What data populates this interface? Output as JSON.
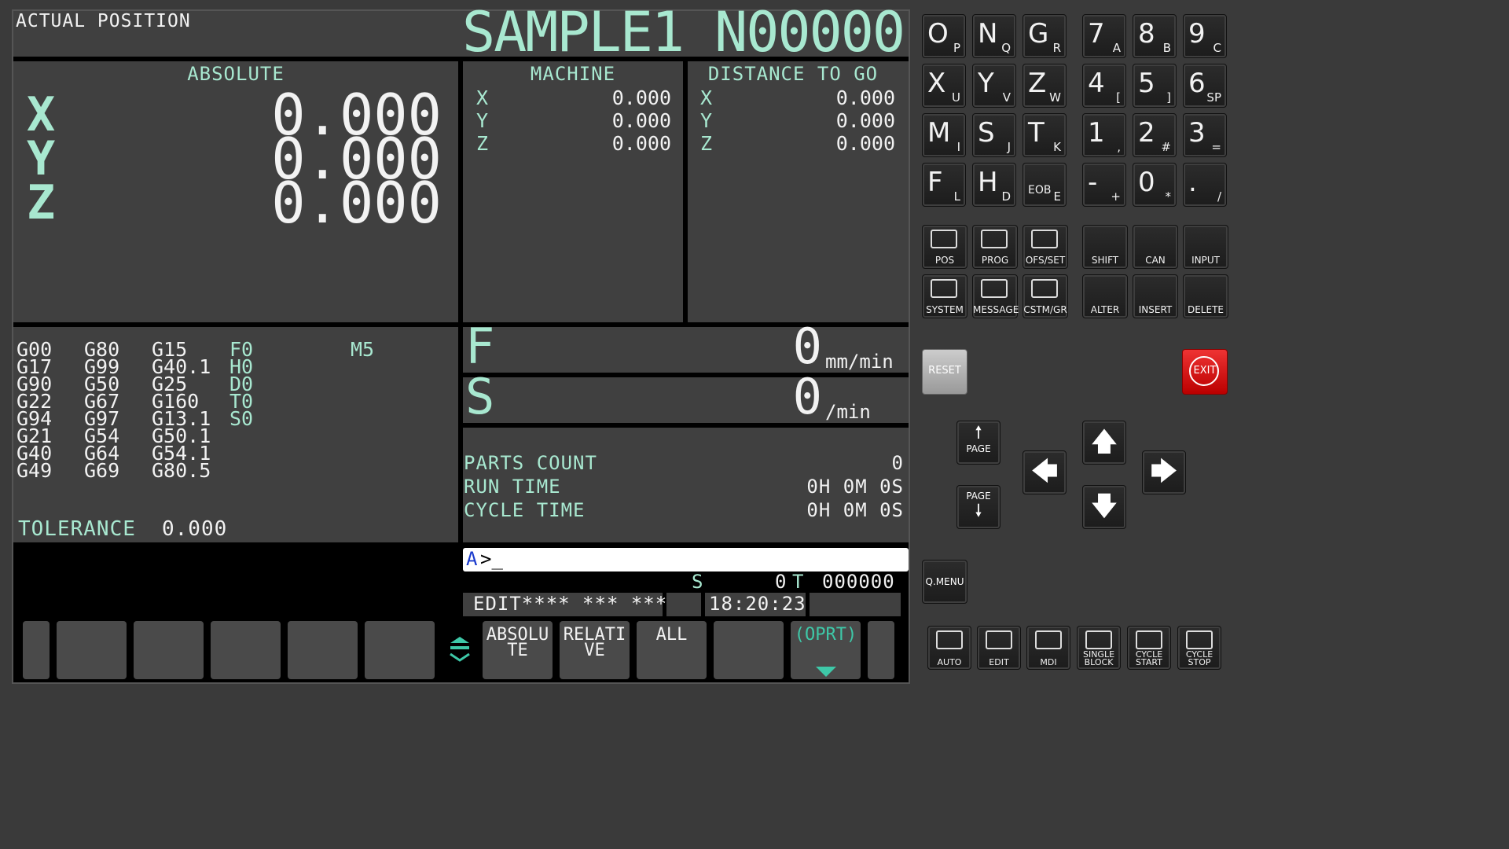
{
  "header": {
    "title": "ACTUAL POSITION",
    "program": "SAMPLE1 N00000"
  },
  "absolute": {
    "title": "ABSOLUTE",
    "axes": [
      "X",
      "Y",
      "Z"
    ],
    "values": [
      "0.000",
      "0.000",
      "0.000"
    ]
  },
  "machine": {
    "title": "MACHINE",
    "axes": [
      "X",
      "Y",
      "Z"
    ],
    "values": [
      "0.000",
      "0.000",
      "0.000"
    ]
  },
  "distance": {
    "title": "DISTANCE TO GO",
    "axes": [
      "X",
      "Y",
      "Z"
    ],
    "values": [
      "0.000",
      "0.000",
      "0.000"
    ]
  },
  "modal": {
    "col1": [
      "G00",
      "G17",
      "G90",
      "G22",
      "G94",
      "G21",
      "G40",
      "G49"
    ],
    "col2": [
      "G80",
      "G99",
      "G50",
      "G67",
      "G97",
      "G54",
      "G64",
      "G69"
    ],
    "col3": [
      "G15",
      "G40.1",
      "G25",
      "G160",
      "G13.1",
      "G50.1",
      "G54.1",
      "G80.5"
    ],
    "col4": [
      "F0",
      "H0",
      "D0",
      "T0",
      "S0"
    ],
    "m": "M5",
    "tolerance_label": "TOLERANCE",
    "tolerance_value": "0.000"
  },
  "feed": {
    "label": "F",
    "value": "0",
    "unit": "mm/min"
  },
  "spindle": {
    "label": "S",
    "value": "0",
    "unit": "/min"
  },
  "counters": {
    "parts_label": "PARTS COUNT",
    "parts_value": "0",
    "run_label": "RUN TIME",
    "run_value": "0H 0M 0S",
    "cycle_label": "CYCLE TIME",
    "cycle_value": "0H 0M 0S"
  },
  "input": {
    "prompt": "A",
    "cursor": ">_"
  },
  "status": {
    "s_label": "S",
    "s_value": "0",
    "t_label": "T",
    "t_value": "000000",
    "mode": "EDIT**** *** ***",
    "time": "18:20:23"
  },
  "softkeys": [
    "ABSOLU TE",
    "RELATI VE",
    "ALL",
    "",
    "(OPRT)"
  ],
  "keypad": {
    "letters": [
      {
        "big": "O",
        "sub": "P"
      },
      {
        "big": "N",
        "sub": "Q"
      },
      {
        "big": "G",
        "sub": "R"
      },
      {
        "big": "X",
        "sub": "U"
      },
      {
        "big": "Y",
        "sub": "V"
      },
      {
        "big": "Z",
        "sub": "W"
      },
      {
        "big": "M",
        "sub": "I"
      },
      {
        "big": "S",
        "sub": "J"
      },
      {
        "big": "T",
        "sub": "K"
      },
      {
        "big": "F",
        "sub": "L"
      },
      {
        "big": "H",
        "sub": "D"
      },
      {
        "big": "EOB",
        "sub": "E"
      }
    ],
    "numbers": [
      {
        "big": "7",
        "sub": "A"
      },
      {
        "big": "8",
        "sub": "B"
      },
      {
        "big": "9",
        "sub": "C"
      },
      {
        "big": "4",
        "sub": "["
      },
      {
        "big": "5",
        "sub": "]"
      },
      {
        "big": "6",
        "sub": "SP"
      },
      {
        "big": "1",
        "sub": ","
      },
      {
        "big": "2",
        "sub": "#"
      },
      {
        "big": "3",
        "sub": "="
      },
      {
        "big": "-",
        "sub": "+"
      },
      {
        "big": "0",
        "sub": "*"
      },
      {
        "big": ".",
        "sub": "/"
      }
    ],
    "func1": [
      "POS",
      "PROG",
      "OFS/SET",
      "SYSTEM",
      "MESSAGE",
      "CSTM/GR"
    ],
    "func2": [
      "SHIFT",
      "CAN",
      "INPUT",
      "ALTER",
      "INSERT",
      "DELETE"
    ],
    "reset": "RESET",
    "exit": "EXIT",
    "page_up": "PAGE",
    "page_down": "PAGE",
    "qmenu": "Q.MENU",
    "modes": [
      "AUTO",
      "EDIT",
      "MDI",
      "SINGLE BLOCK",
      "CYCLE START",
      "CYCLE STOP"
    ]
  }
}
